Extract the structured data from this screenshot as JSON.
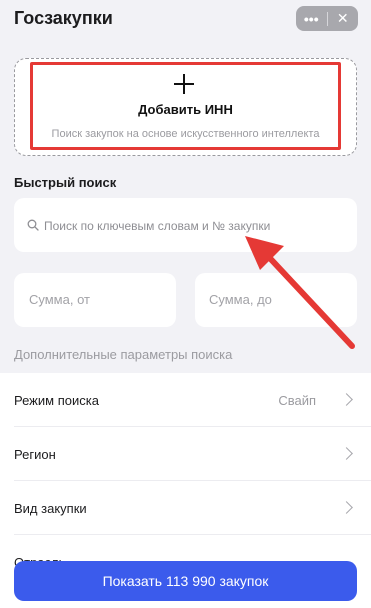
{
  "header": {
    "title": "Госзакупки",
    "more_icon": "more-dots-icon",
    "close_icon": "close-icon"
  },
  "add_inn": {
    "label": "Добавить ИНН",
    "subtitle": "Поиск закупок на основе искусственного интеллекта",
    "icon": "plus-icon"
  },
  "quick_search": {
    "title": "Быстрый поиск",
    "placeholder": "Поиск по ключевым словам и № закупки",
    "icon": "search-icon"
  },
  "sum": {
    "from_placeholder": "Сумма, от",
    "to_placeholder": "Сумма, до"
  },
  "extra_params": {
    "title": "Дополнительные параметры поиска",
    "items": [
      {
        "label": "Режим поиска",
        "value": "Свайп"
      },
      {
        "label": "Регион",
        "value": ""
      },
      {
        "label": "Вид закупки",
        "value": ""
      },
      {
        "label": "Отрасль",
        "value": ""
      }
    ]
  },
  "action": {
    "show_label": "Показать 113 990 закупок"
  },
  "colors": {
    "accent": "#3b5bec",
    "annotation": "#e53935",
    "background": "#f2f2f6"
  }
}
